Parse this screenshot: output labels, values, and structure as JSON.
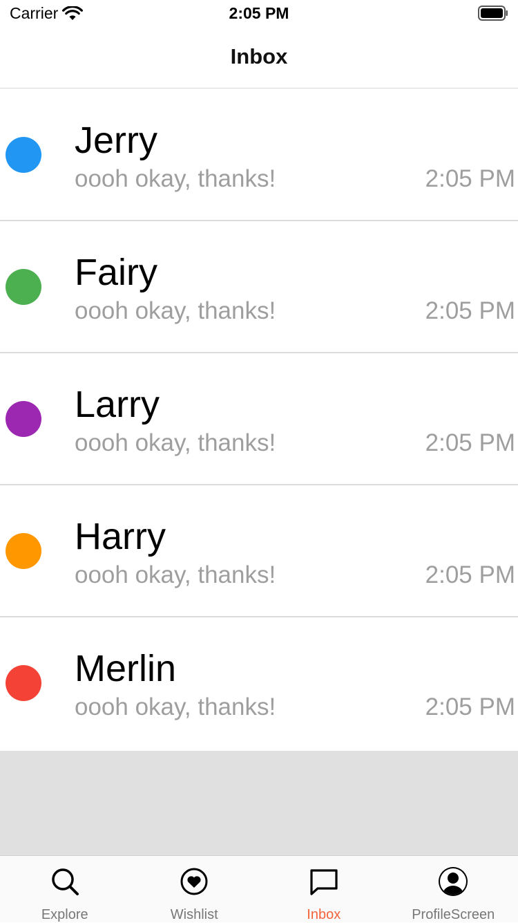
{
  "status_bar": {
    "carrier": "Carrier",
    "time": "2:05 PM"
  },
  "nav": {
    "title": "Inbox"
  },
  "conversations": [
    {
      "name": "Jerry",
      "message": "oooh okay, thanks!",
      "time": "2:05 PM",
      "color": "#2196f3"
    },
    {
      "name": "Fairy",
      "message": "oooh okay, thanks!",
      "time": "2:05 PM",
      "color": "#4caf50"
    },
    {
      "name": "Larry",
      "message": "oooh okay, thanks!",
      "time": "2:05 PM",
      "color": "#9c27b0"
    },
    {
      "name": "Harry",
      "message": "oooh okay, thanks!",
      "time": "2:05 PM",
      "color": "#ff9800"
    },
    {
      "name": "Merlin",
      "message": "oooh okay, thanks!",
      "time": "2:05 PM",
      "color": "#f44336"
    }
  ],
  "tabs": [
    {
      "label": "Explore",
      "icon": "search-icon",
      "active": false
    },
    {
      "label": "Wishlist",
      "icon": "heart-icon",
      "active": false
    },
    {
      "label": "Inbox",
      "icon": "chat-bubble-icon",
      "active": true
    },
    {
      "label": "ProfileScreen",
      "icon": "user-circle-icon",
      "active": false
    }
  ],
  "colors": {
    "active_tab": "#f4623a",
    "inactive_tab": "#777777"
  }
}
